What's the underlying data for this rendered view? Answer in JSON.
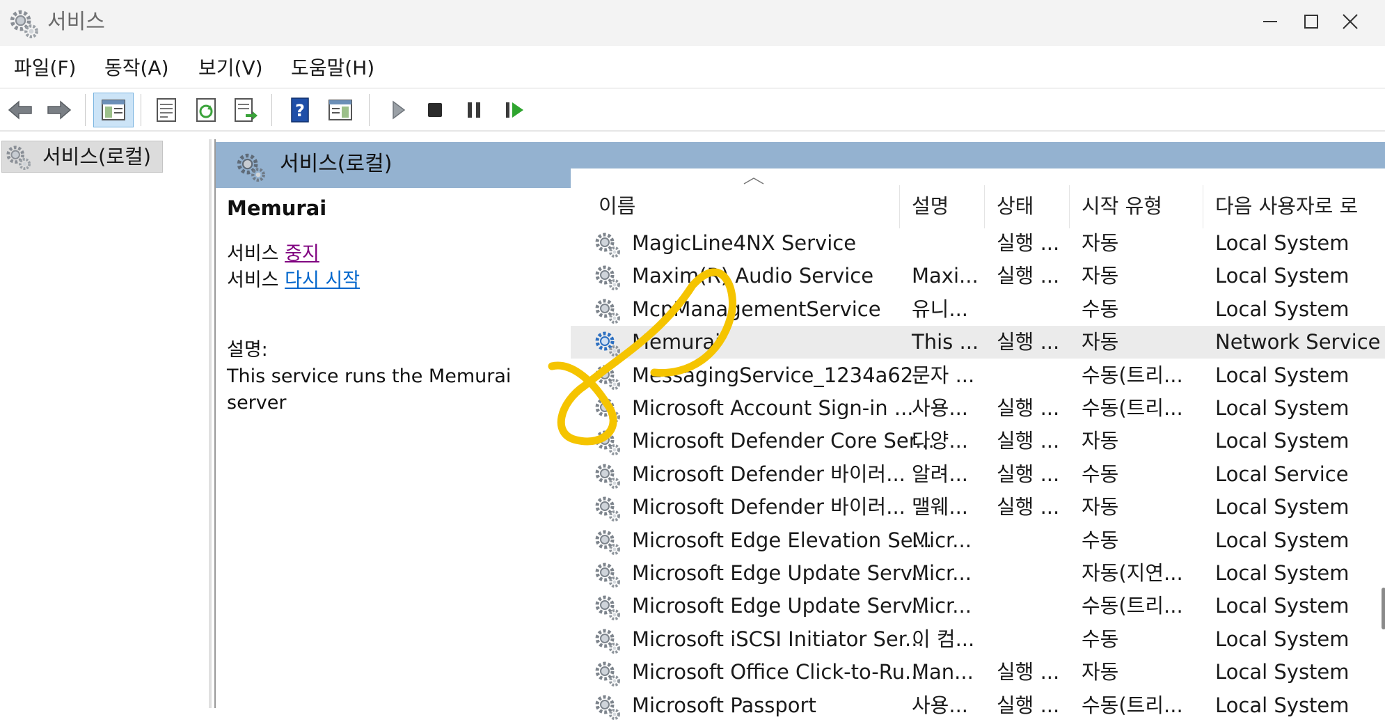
{
  "window": {
    "title": "서비스",
    "minimize_label": "",
    "maximize_label": "",
    "close_label": ""
  },
  "menu": [
    {
      "label": "파일(F)"
    },
    {
      "label": "동작(A)"
    },
    {
      "label": "보기(V)"
    },
    {
      "label": "도움말(H)"
    }
  ],
  "toolbar": {
    "icons": [
      "back-arrow-icon",
      "forward-arrow-icon",
      "show-hide-console-tree-icon",
      "properties-icon",
      "refresh-icon",
      "export-list-icon",
      "help-icon",
      "show-action-pane-icon",
      "start-service-icon",
      "stop-service-icon",
      "pause-service-icon",
      "resume-service-icon"
    ]
  },
  "tree": {
    "root_label": "서비스(로컬)"
  },
  "pane": {
    "header": "서비스(로컬)",
    "selected_name": "Memurai",
    "stop_prefix": "서비스 ",
    "stop_link": "중지",
    "restart_prefix": "서비스 ",
    "restart_link": "다시 시작",
    "desc_label": "설명:",
    "desc_text": "This service runs the Memurai server"
  },
  "columns": {
    "name": "이름",
    "description": "설명",
    "status": "상태",
    "startup": "시작 유형",
    "logon": "다음 사용자로 로"
  },
  "rows": [
    {
      "name": "MagicLine4NX Service",
      "desc": "",
      "status": "실행 ...",
      "startup": "자동",
      "logon": "Local System"
    },
    {
      "name": "Maxim(R) Audio Service",
      "desc": "Maxi...",
      "status": "실행 ...",
      "startup": "자동",
      "logon": "Local System"
    },
    {
      "name": "McpManagementService",
      "desc": "유니...",
      "status": "",
      "startup": "수동",
      "logon": "Local System"
    },
    {
      "name": "Memurai",
      "desc": "This ...",
      "status": "실행 ...",
      "startup": "자동",
      "logon": "Network Service",
      "selected": true
    },
    {
      "name": "MessagingService_1234a62",
      "desc": "문자 ...",
      "status": "",
      "startup": "수동(트리...",
      "logon": "Local System"
    },
    {
      "name": "Microsoft Account Sign-in ...",
      "desc": "사용...",
      "status": "실행 ...",
      "startup": "수동(트리...",
      "logon": "Local System"
    },
    {
      "name": "Microsoft Defender Core Ser...",
      "desc": "다양...",
      "status": "실행 ...",
      "startup": "자동",
      "logon": "Local System"
    },
    {
      "name": "Microsoft Defender 바이러...",
      "desc": "알려...",
      "status": "실행 ...",
      "startup": "수동",
      "logon": "Local Service"
    },
    {
      "name": "Microsoft Defender 바이러...",
      "desc": "맬웨...",
      "status": "실행 ...",
      "startup": "자동",
      "logon": "Local System"
    },
    {
      "name": "Microsoft Edge Elevation Se...",
      "desc": "Micr...",
      "status": "",
      "startup": "수동",
      "logon": "Local System"
    },
    {
      "name": "Microsoft Edge Update Serv...",
      "desc": "Micr...",
      "status": "",
      "startup": "자동(지연...",
      "logon": "Local System"
    },
    {
      "name": "Microsoft Edge Update Serv...",
      "desc": "Micr...",
      "status": "",
      "startup": "수동(트리...",
      "logon": "Local System"
    },
    {
      "name": "Microsoft iSCSI Initiator Ser...",
      "desc": "이 컴...",
      "status": "",
      "startup": "수동",
      "logon": "Local System"
    },
    {
      "name": "Microsoft Office Click-to-Ru...",
      "desc": "Man...",
      "status": "실행 ...",
      "startup": "자동",
      "logon": "Local System"
    },
    {
      "name": "Microsoft Passport",
      "desc": "사용...",
      "status": "실행 ...",
      "startup": "수동(트리...",
      "logon": "Local System"
    }
  ],
  "colors": {
    "header_bg": "#94b2d0",
    "selected_row": "#ebebeb",
    "annotation": "#f5c400",
    "link": "#0066cc",
    "visited_link": "#800080"
  }
}
